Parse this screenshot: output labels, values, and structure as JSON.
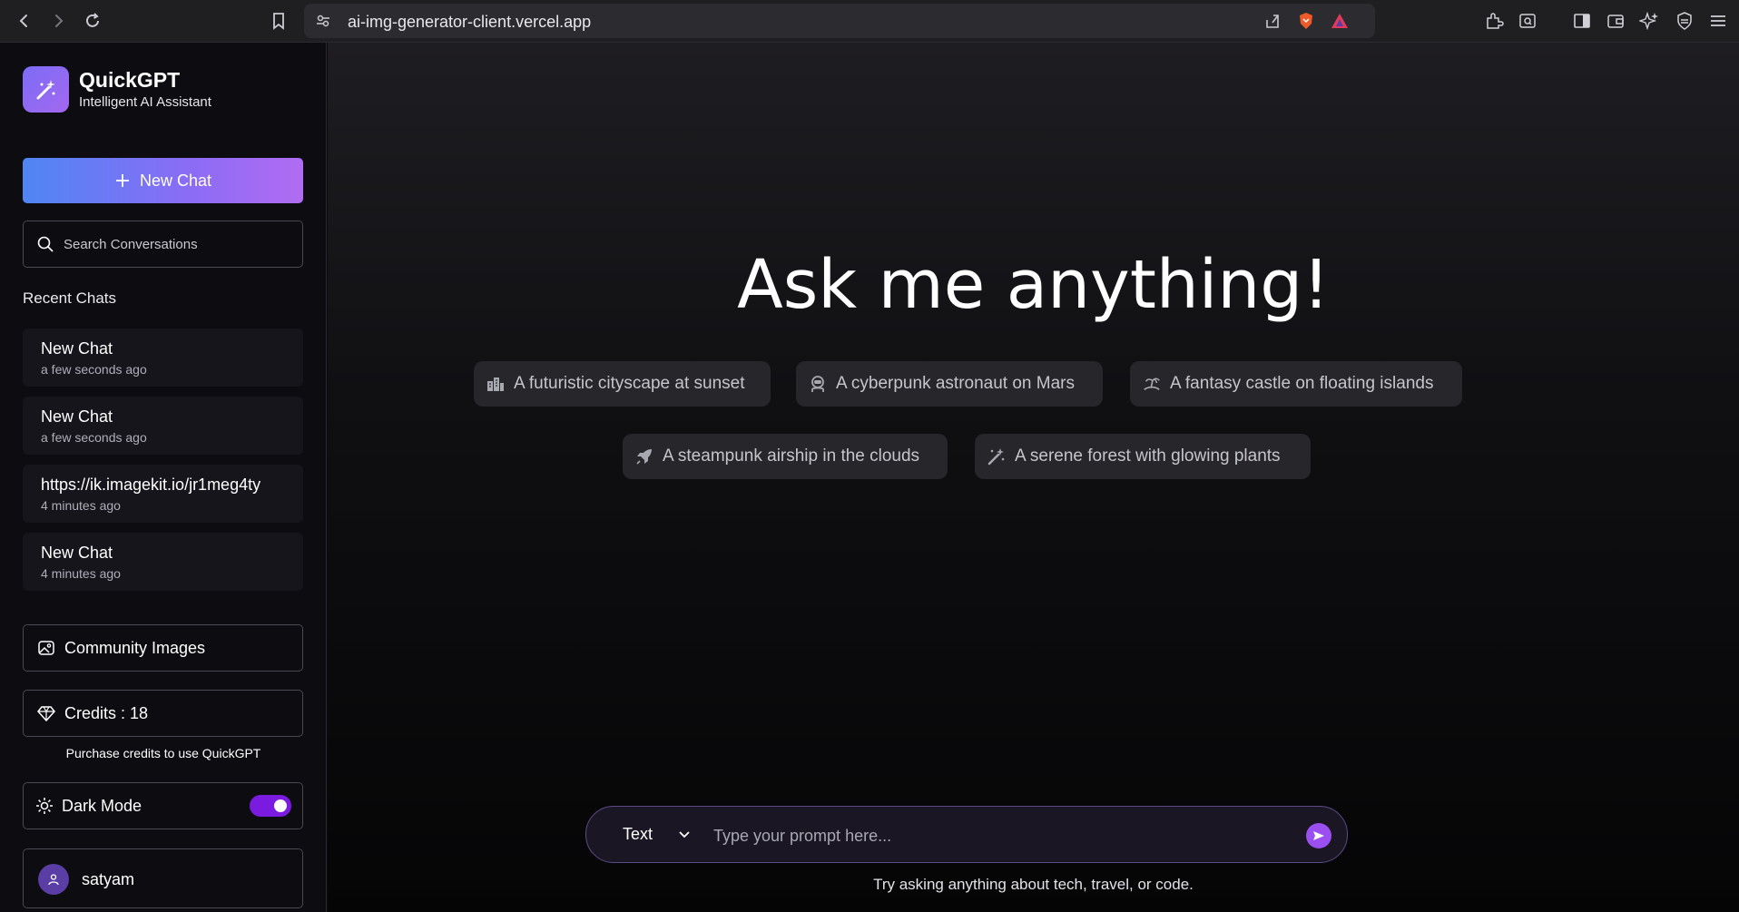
{
  "browser": {
    "url": "ai-img-generator-client.vercel.app",
    "icons": [
      "back-icon",
      "forward-icon",
      "reload-icon",
      "bookmark-icon",
      "site-settings-icon",
      "share-icon",
      "brave-shield-icon",
      "brave-rewards-icon",
      "extensions-icon",
      "search-tabs-icon",
      "sidebar-icon",
      "wallet-icon",
      "leo-ai-icon",
      "vpn-icon",
      "menu-icon"
    ]
  },
  "sidebar": {
    "brand_title": "QuickGPT",
    "brand_subtitle": "Intelligent AI Assistant",
    "new_chat_label": "New Chat",
    "search_placeholder": "Search Conversations",
    "recent_title": "Recent Chats",
    "recent_chats": [
      {
        "title": "New Chat",
        "time": "a few seconds ago"
      },
      {
        "title": "New Chat",
        "time": "a few seconds ago"
      },
      {
        "title": "https://ik.imagekit.io/jr1meg4ty",
        "time": "4 minutes ago"
      },
      {
        "title": "New Chat",
        "time": "4 minutes ago"
      }
    ],
    "community_label": "Community Images",
    "credits_label": "Credits : 18",
    "credits_note": "Purchase credits to use QuickGPT",
    "dark_mode_label": "Dark Mode",
    "dark_mode_on": true,
    "user_name": "satyam"
  },
  "main": {
    "headline": "Ask me anything!",
    "suggestions": [
      {
        "label": "A futuristic cityscape at sunset",
        "icon": "city-icon"
      },
      {
        "label": "A cyberpunk astronaut on Mars",
        "icon": "astronaut-icon"
      },
      {
        "label": "A fantasy castle on floating islands",
        "icon": "island-icon"
      },
      {
        "label": "A steampunk airship in the clouds",
        "icon": "rocket-icon"
      },
      {
        "label": "A serene forest with glowing plants",
        "icon": "magic-wand-icon"
      }
    ],
    "mode_value": "Text",
    "prompt_placeholder": "Type your prompt here...",
    "hint": "Try asking anything about tech, travel, or code."
  },
  "colors": {
    "accent": "#9b4ff0",
    "gradient_start": "#4f86f4",
    "gradient_end": "#b16cf2",
    "toggle": "#7b1be0"
  }
}
